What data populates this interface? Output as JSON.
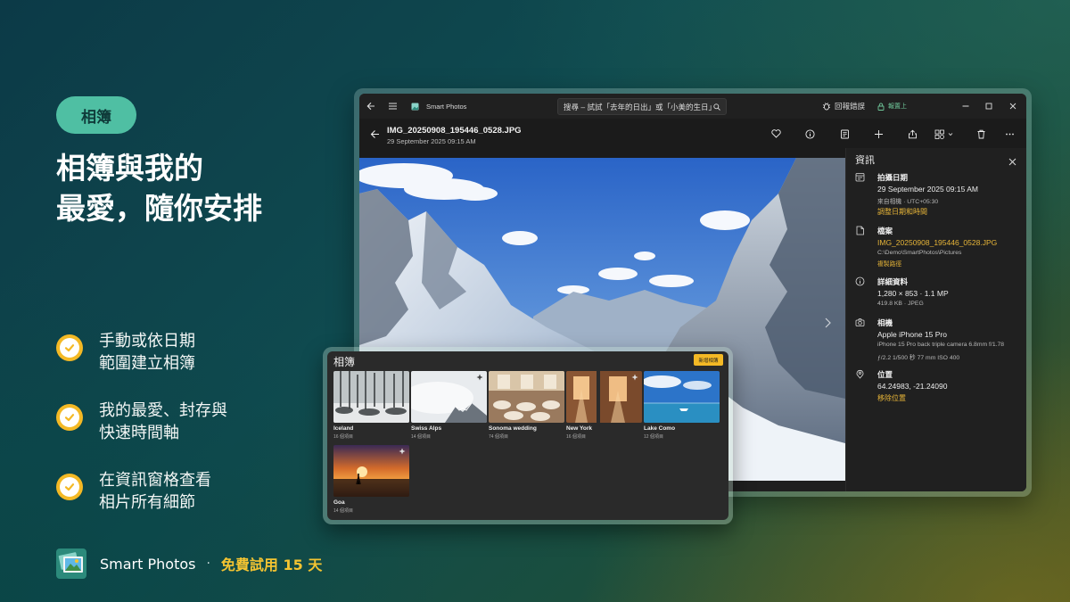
{
  "promo": {
    "pill": "相簿",
    "headline": [
      "相簿與我的",
      "最愛，隨你安排"
    ],
    "features": [
      {
        "line1": "手動或依日期",
        "line2": "範圍建立相簿"
      },
      {
        "line1": "我的最愛、封存與",
        "line2": "快速時間軸"
      },
      {
        "line1": "在資訊窗格查看",
        "line2": "相片所有細節"
      }
    ],
    "footer": {
      "app_name": "Smart Photos",
      "separator": "·",
      "trial": "免費試用 15 天"
    }
  },
  "window": {
    "title": "Smart Photos",
    "search_placeholder": "搜尋 – 試試「去年的日出」或「小美的生日」",
    "report_bug": "回報錯誤",
    "sign_in": "報置上",
    "file": {
      "name": "IMG_20250908_195446_0528.JPG",
      "date": "29 September 2025 09:15 AM"
    }
  },
  "info": {
    "title": "資訊",
    "date": {
      "label": "拍攝日期",
      "value": "29 September 2025 09:15 AM",
      "sub": "來自相機 · UTC+05:30",
      "link": "調整日期和時間"
    },
    "file": {
      "label": "檔案",
      "value": "IMG_20250908_195446_0528.JPG",
      "sub": "C:\\Demo\\SmartPhotos\\Pictures",
      "link": "複製路徑"
    },
    "details": {
      "label": "詳細資料",
      "value": "1,280 × 853 · 1.1 MP",
      "sub": "419.8 KB · JPEG"
    },
    "camera": {
      "label": "相機",
      "value": "Apple iPhone 15 Pro",
      "sub": "iPhone 15 Pro back triple camera 6.8mm f/1.78",
      "sub2": "ƒ/2.2   1/500 秒   77 mm   ISO 400"
    },
    "location": {
      "label": "位置",
      "value": "64.24983, -21.24090",
      "link": "移除位置"
    }
  },
  "albums": {
    "title": "相簿",
    "new_button": "新增相簿",
    "items": [
      {
        "name": "Iceland",
        "count": "16 個項目"
      },
      {
        "name": "Swiss Alps",
        "count": "14 個項目"
      },
      {
        "name": "Sonoma wedding",
        "count": "74 個項目"
      },
      {
        "name": "New York",
        "count": "16 個項目"
      },
      {
        "name": "Lake Como",
        "count": "12 個項目"
      },
      {
        "name": "Goa",
        "count": "14 個項目"
      }
    ]
  },
  "colors": {
    "accent": "#f4b925",
    "pill": "#4fbfa3",
    "link": "#e7b538"
  }
}
